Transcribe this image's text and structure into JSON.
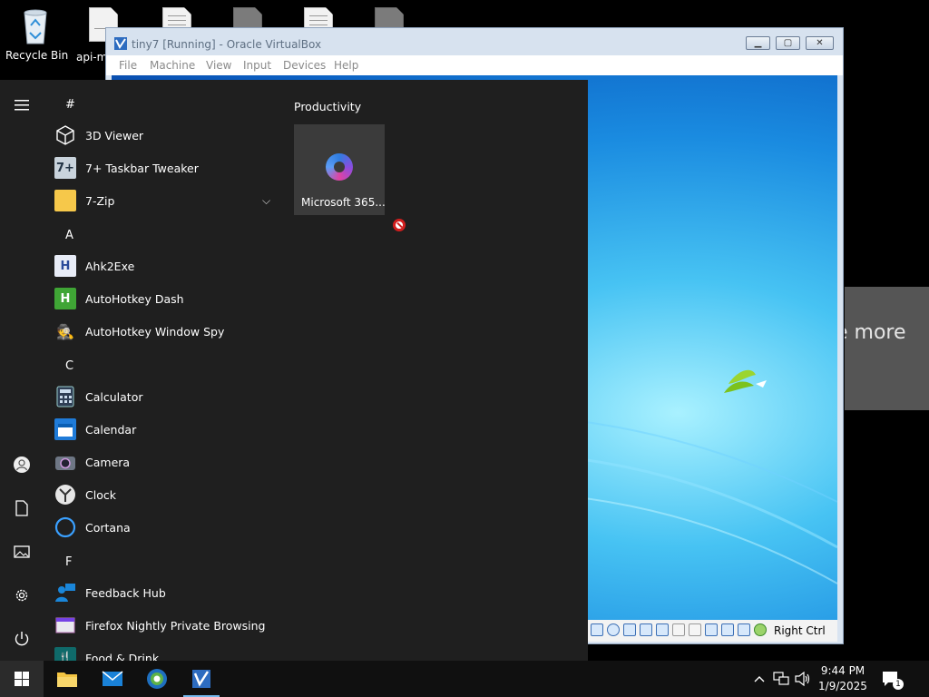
{
  "desktop": {
    "icons": [
      {
        "label": "Recycle Bin"
      },
      {
        "label": "api-m"
      },
      {
        "label": ""
      },
      {
        "label": ""
      },
      {
        "label": ""
      },
      {
        "label": ""
      }
    ]
  },
  "virtualbox": {
    "title": "tiny7 [Running] - Oracle VirtualBox",
    "menu": [
      "File",
      "Machine",
      "View",
      "Input",
      "Devices",
      "Help"
    ],
    "host_key": "Right Ctrl"
  },
  "side_toast": {
    "text": "e more"
  },
  "start_menu": {
    "sections": [
      {
        "letter": "#",
        "apps": [
          "3D Viewer",
          "7+ Taskbar Tweaker",
          "7-Zip"
        ]
      },
      {
        "letter": "A",
        "apps": [
          "Ahk2Exe",
          "AutoHotkey Dash",
          "AutoHotkey Window Spy"
        ]
      },
      {
        "letter": "C",
        "apps": [
          "Calculator",
          "Calendar",
          "Camera",
          "Clock",
          "Cortana"
        ]
      },
      {
        "letter": "F",
        "apps": [
          "Feedback Hub",
          "Firefox Nightly Private Browsing",
          "Food & Drink"
        ]
      }
    ],
    "group_title": "Productivity",
    "tile_label": "Microsoft 365..."
  },
  "taskbar": {
    "time": "9:44 PM",
    "date": "1/9/2025",
    "notification_count": "1"
  },
  "colors": {
    "start_bg": "#1f1f1f",
    "taskbar_bg": "#101010",
    "accent": "#76b9ed"
  }
}
